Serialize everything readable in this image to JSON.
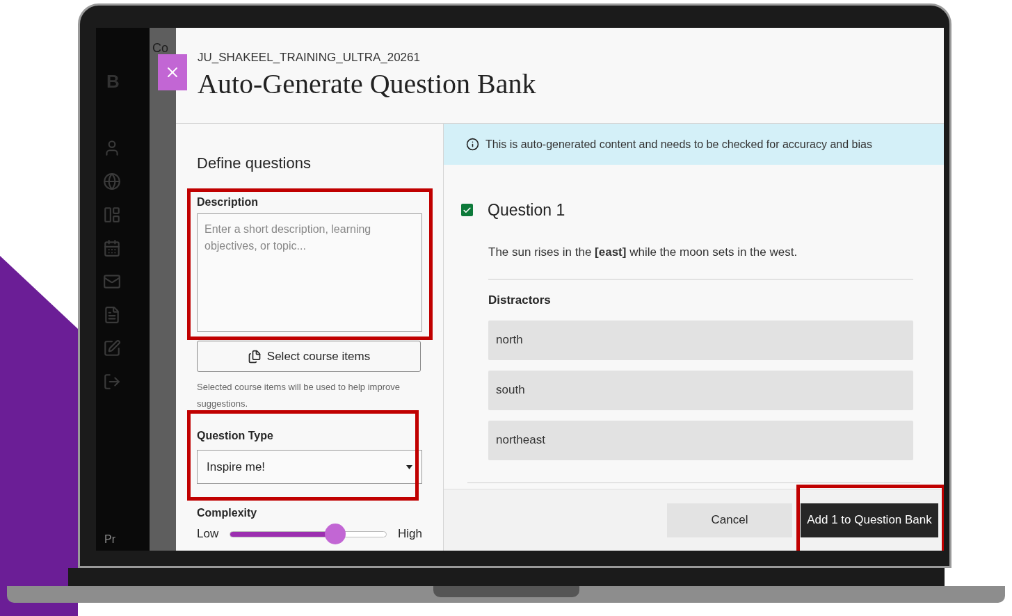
{
  "background_app": {
    "fragments": [
      "Co",
      "B",
      "Pr"
    ]
  },
  "modal": {
    "course": "JU_SHAKEEL_TRAINING_ULTRA_20261",
    "title": "Auto-Generate Question Bank"
  },
  "define": {
    "heading": "Define questions",
    "description": {
      "label": "Description",
      "placeholder": "Enter a short description, learning objectives, or topic..."
    },
    "select_items_button": "Select course items",
    "helper": "Selected course items will be used to help improve suggestions.",
    "question_type": {
      "label": "Question Type",
      "value": "Inspire me!"
    },
    "complexity": {
      "label": "Complexity",
      "min_label": "Low",
      "max_label": "High",
      "level": 0.67
    }
  },
  "notice": "This is auto-generated content and needs to be checked for accuracy and bias",
  "questions": [
    {
      "title": "Question 1",
      "checked": true,
      "text": "The sun rises in the **[east]** while the moon sets in the west.",
      "distractors_label": "Distractors",
      "distractors": [
        "north",
        "south",
        "northeast"
      ]
    }
  ],
  "footer": {
    "cancel": "Cancel",
    "submit": "Add 1 to Question Bank"
  }
}
